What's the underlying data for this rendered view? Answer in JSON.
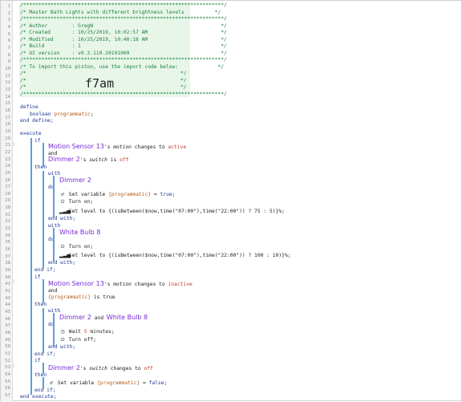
{
  "header": {
    "l1": "/******************************************************************/",
    "l2": "/* Master Bath Lights with different brightness levels          */",
    "l3": "/******************************************************************/",
    "l4": "/* Author        : GregN                                          */",
    "l5": "/* Created       : 10/25/2019, 10:02:57 AM                        */",
    "l6": "/* Modified      : 10/25/2019, 10:40:18 AM                        */",
    "l7": "/* Build         : 1                                              */",
    "l8": "/* UI version    : v0.3.110.20191009                              */",
    "l9": "/******************************************************************/",
    "l10": "/* To import this piston, use the import code below:             */",
    "l11a": "/*",
    "l11b": "*/",
    "l12a": "/*",
    "l12b": "*/",
    "l13a": "/*",
    "l13b": "*/",
    "l14": "/******************************************************************/",
    "import_code": "f7am"
  },
  "code": {
    "define": "define",
    "boolean": "boolean",
    "programmatic_var": "programmatic",
    "semicolon": ";",
    "end_define": "end define;",
    "execute": "execute",
    "if": "if",
    "and": "and",
    "then": "then",
    "with": "with",
    "do": "do",
    "end_with": "end with;",
    "end_if": "end if;",
    "end_execute": "end execute;",
    "motion_sensor": "Motion Sensor 13",
    "dimmer2": "Dimmer 2",
    "white_bulb": "White Bulb 8",
    "s_motion": "'s",
    "motion_attr": "motion",
    "changes_to": "changes to",
    "active": "active",
    "inactive": "inactive",
    "switch_attr": "switch",
    "is": "is",
    "off": "off",
    "true_val": "true",
    "var_paren": "{programmatic}",
    "set_var_prog_true": "Set variable {programmatic} = true;",
    "set_var_prog_false": "Set variable {programmatic} = false;",
    "turn_on": "Turn on;",
    "turn_off": "Turn off;",
    "set_level_1": "Set level to {(isBetween($now,time(\"07:00\"),time(\"22:00\")) ? 75 : 5)}%;",
    "set_level_2": "Set level to {(isBetween($now,time(\"07:00\"),time(\"22:00\")) ? 100 : 10)}%;",
    "wait": "Wait",
    "wait_num": "5",
    "minutes": "minutes;",
    "dimmer_and": "and",
    "is_true_text": "is true"
  },
  "line_numbers": [
    "1",
    "2",
    "3",
    "4",
    "5",
    "6",
    "7",
    "8",
    "9",
    "10",
    "11",
    "12",
    "13",
    "14",
    "15",
    "16",
    "17",
    "18",
    "19",
    "20",
    "21",
    "22",
    "23",
    "24",
    "25",
    "26",
    "27",
    "28",
    "29",
    "30",
    "31",
    "32",
    "33",
    "34",
    "35",
    "36",
    "37",
    "38",
    "39",
    "40",
    "41",
    "42",
    "43",
    "44",
    "45",
    "46",
    "47",
    "48",
    "49",
    "50",
    "51",
    "52",
    "53",
    "54",
    "55",
    "56",
    "57"
  ],
  "icons": {
    "variable": "x-variable-icon",
    "power": "power-icon",
    "level": "signal-bars-icon",
    "clock": "clock-icon",
    "fold": "fold-marker-icon"
  },
  "colors": {
    "comment": "#1a7f37",
    "keyword": "#1f3a93",
    "device": "#7a2bd6",
    "value": "#c0392b",
    "variable": "#b35a1a",
    "guide": "#5aa0d8"
  }
}
